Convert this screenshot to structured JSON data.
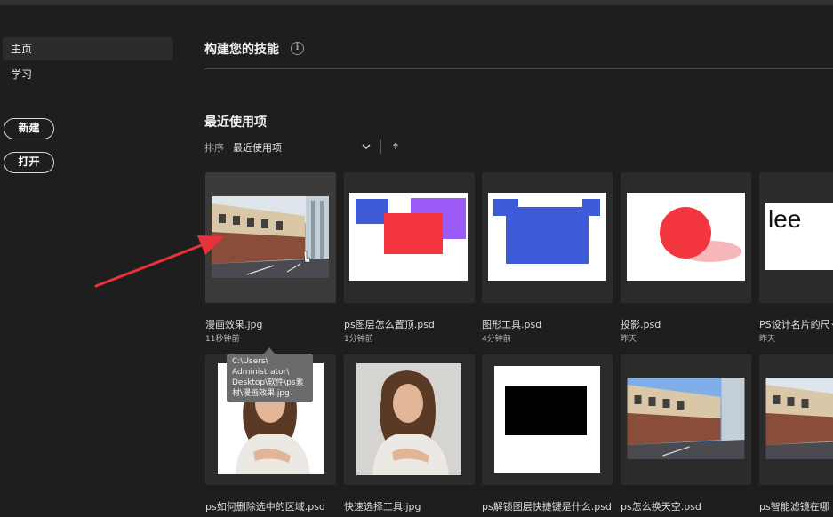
{
  "sidebar": {
    "items": [
      {
        "label": "主页",
        "active": true
      },
      {
        "label": "学习",
        "active": false
      }
    ],
    "new_button": "新建",
    "open_button": "打开"
  },
  "main": {
    "skills_title": "构建您的技能",
    "recent_title": "最近使用项",
    "sort_label": "排序",
    "sort_value": "最近使用项"
  },
  "files": [
    {
      "name": "漫画效果.jpg",
      "time": "11秒钟前",
      "thumb": "street"
    },
    {
      "name": "ps图层怎么置顶.psd",
      "time": "1分钟前",
      "thumb": "layers"
    },
    {
      "name": "图形工具.psd",
      "time": "4分钟前",
      "thumb": "shape"
    },
    {
      "name": "投影.psd",
      "time": "昨天",
      "thumb": "shadow"
    },
    {
      "name": "PS设计名片的尺寸",
      "time": "昨天",
      "thumb": "lee"
    },
    {
      "name": "ps如何删除选中的区域.psd",
      "time": "",
      "thumb": "portrait-cut"
    },
    {
      "name": "快速选择工具.jpg",
      "time": "",
      "thumb": "portrait"
    },
    {
      "name": "ps解锁图层快捷键是什么.psd",
      "time": "",
      "thumb": "black-rect"
    },
    {
      "name": "ps怎么换天空.psd",
      "time": "",
      "thumb": "street2"
    },
    {
      "name": "ps智能滤镜在哪",
      "time": "",
      "thumb": "street3"
    }
  ],
  "tooltip": {
    "lines": [
      "C:\\Users\\",
      "Administrator\\",
      "Desktop\\软件\\ps素",
      "材\\漫画效果.jpg"
    ]
  },
  "colors": {
    "background": "#1e1e1e",
    "blue_shape": "#3d5bd6",
    "red_shape": "#f2353f",
    "purple_shape": "#9b59f5",
    "annotation_arrow": "#e8323a"
  }
}
